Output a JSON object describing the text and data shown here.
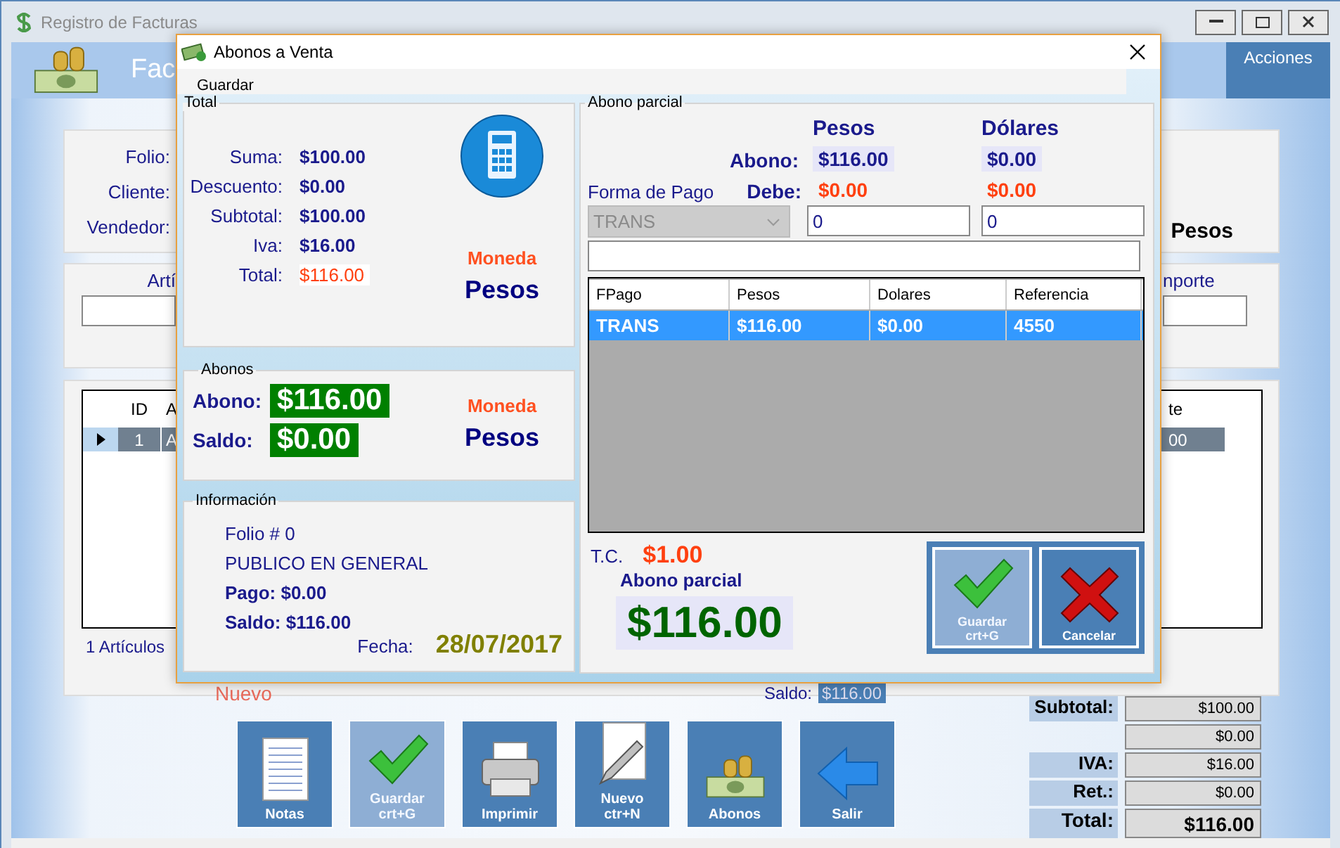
{
  "main_window": {
    "title": "Registro de Facturas",
    "header_title": "Fac",
    "actions_button": "Acciones",
    "form": {
      "labels": [
        "Folio:",
        "Cliente:",
        "Vendedor:"
      ],
      "currency": "Pesos",
      "article_label": "Artí",
      "amount_label": "nporte"
    },
    "items_grid": {
      "columns": [
        "ID",
        "A"
      ],
      "last_column": "te",
      "rows": [
        {
          "cells": [
            "1",
            "A"
          ],
          "last_cell": "00",
          "selected": true
        }
      ]
    },
    "article_count": "1 Artículos",
    "status": "Nuevo",
    "saldo_label": "Saldo:",
    "saldo_value": "$116.00",
    "toolbar": [
      {
        "label": "Notas",
        "kind": "notes",
        "disabled": false
      },
      {
        "label": "Guardar",
        "shortcut": "crt+G",
        "kind": "check",
        "disabled": true
      },
      {
        "label": "Imprimir",
        "kind": "printer",
        "disabled": false
      },
      {
        "label": "Nuevo",
        "shortcut": "ctr+N",
        "kind": "pencil",
        "disabled": false
      },
      {
        "label": "Abonos",
        "kind": "money",
        "disabled": false
      },
      {
        "label": "Salir",
        "kind": "arrow",
        "disabled": false
      }
    ],
    "totals": [
      {
        "label": "Subtotal:",
        "value": "$100.00",
        "kind": "line"
      },
      {
        "value": "$0.00",
        "kind": "line"
      },
      {
        "label": "IVA:",
        "value": "$16.00",
        "kind": "line"
      },
      {
        "label": "Ret.:",
        "value": "$0.00",
        "kind": "line"
      },
      {
        "label": "Total:",
        "value": "$116.00",
        "kind": "grand"
      }
    ]
  },
  "dialog": {
    "title": "Abonos a Venta",
    "menu": [
      "Guardar"
    ],
    "total_group": {
      "title": "Total",
      "rows": [
        {
          "label": "Suma:",
          "value": "$100.00",
          "kind": "plain"
        },
        {
          "label": "Descuento:",
          "value": "$0.00",
          "kind": "plain"
        },
        {
          "label": "Subtotal:",
          "value": "$100.00",
          "kind": "plain"
        },
        {
          "label": "Iva:",
          "value": "$16.00",
          "kind": "plain"
        },
        {
          "label": "Total:",
          "value": "$116.00",
          "kind": "highlight"
        }
      ],
      "currency_label": "Moneda",
      "currency": "Pesos"
    },
    "abonos_group": {
      "title": "Abonos",
      "abono_label": "Abono:",
      "abono": "$116.00",
      "saldo_label": "Saldo:",
      "saldo": "$0.00",
      "currency_label": "Moneda",
      "currency": "Pesos"
    },
    "info_group": {
      "title": "Información",
      "folio": "Folio # 0",
      "client": "PUBLICO EN GENERAL",
      "pago": "Pago: $0.00",
      "saldo": "Saldo: $116.00",
      "date_label": "Fecha:",
      "date": "28/07/2017"
    },
    "partial_group": {
      "title": "Abono parcial",
      "col_headers": [
        "Pesos",
        "Dólares"
      ],
      "abono_label": "Abono:",
      "abono": [
        "$116.00",
        "$0.00"
      ],
      "debe_label": "Debe:",
      "debe": [
        "$0.00",
        "$0.00"
      ],
      "payment_label": "Forma de Pago",
      "payment_method": {
        "value": "TRANS",
        "disabled": true
      },
      "amount_inputs": [
        "0",
        "0"
      ],
      "grid": {
        "columns": [
          "FPago",
          "Pesos",
          "Dolares",
          "Referencia"
        ],
        "rows": [
          {
            "cells": [
              "TRANS",
              "$116.00",
              "$0.00",
              "4550"
            ],
            "selected": true
          }
        ]
      },
      "tc_label": "T.C.",
      "tc": "$1.00",
      "partial_label": "Abono parcial",
      "partial_amount": "$116.00",
      "buttons": [
        {
          "label": "Guardar",
          "shortcut": "crt+G",
          "kind": "check",
          "disabled": true
        },
        {
          "label": "Cancelar",
          "kind": "cross",
          "disabled": false
        }
      ]
    }
  }
}
